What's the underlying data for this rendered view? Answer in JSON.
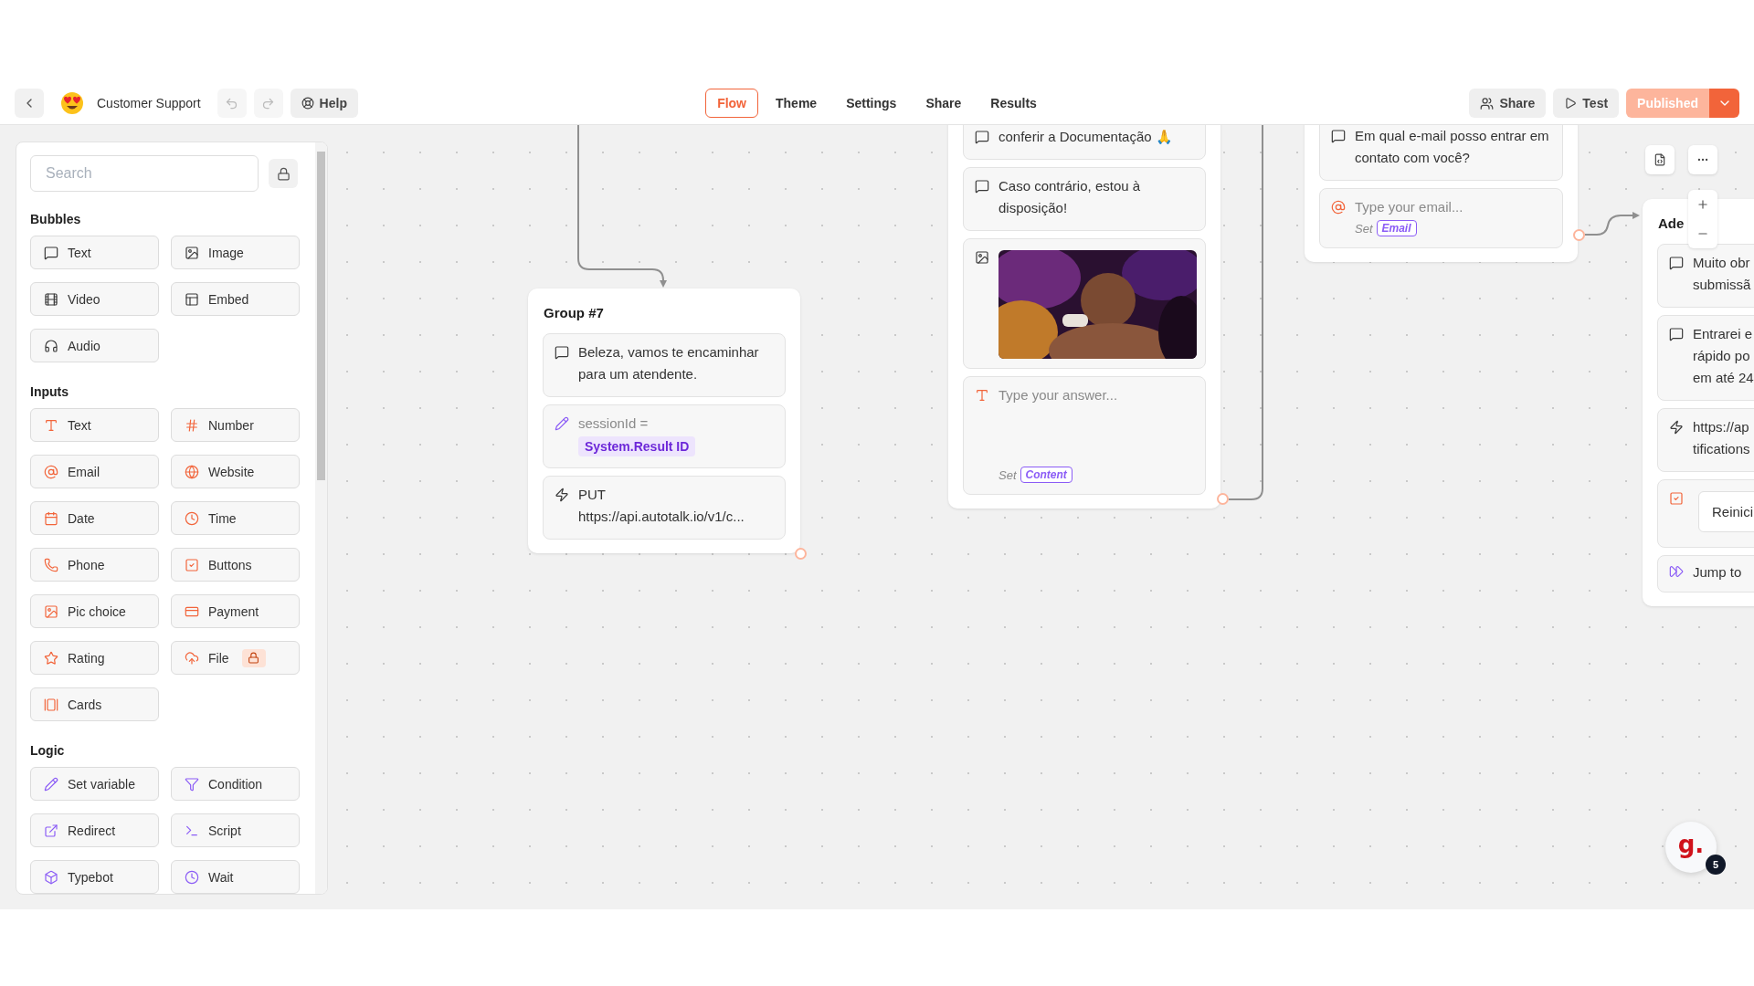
{
  "topbar": {
    "bot_name": "Customer Support",
    "help": "Help",
    "tabs": [
      {
        "label": "Flow",
        "selected": true
      },
      {
        "label": "Theme",
        "selected": false
      },
      {
        "label": "Settings",
        "selected": false
      },
      {
        "label": "Share",
        "selected": false
      },
      {
        "label": "Results",
        "selected": false
      }
    ],
    "share": "Share",
    "test": "Test",
    "publish": "Published"
  },
  "sidebar": {
    "search_placeholder": "Search",
    "sections": [
      {
        "title": "Bubbles",
        "items": [
          {
            "label": "Text",
            "kind": "bubble_text",
            "locked": false
          },
          {
            "label": "Image",
            "kind": "bubble_image",
            "locked": false
          },
          {
            "label": "Video",
            "kind": "bubble_video",
            "locked": false
          },
          {
            "label": "Embed",
            "kind": "bubble_embed",
            "locked": false
          },
          {
            "label": "Audio",
            "kind": "bubble_audio",
            "locked": false
          }
        ]
      },
      {
        "title": "Inputs",
        "items": [
          {
            "label": "Text",
            "kind": "input_text",
            "locked": false
          },
          {
            "label": "Number",
            "kind": "input_number",
            "locked": false
          },
          {
            "label": "Email",
            "kind": "input_email",
            "locked": false
          },
          {
            "label": "Website",
            "kind": "input_website",
            "locked": false
          },
          {
            "label": "Date",
            "kind": "input_date",
            "locked": false
          },
          {
            "label": "Time",
            "kind": "input_time",
            "locked": false
          },
          {
            "label": "Phone",
            "kind": "input_phone",
            "locked": false
          },
          {
            "label": "Buttons",
            "kind": "buttons",
            "locked": false
          },
          {
            "label": "Pic choice",
            "kind": "input_pic",
            "locked": false
          },
          {
            "label": "Payment",
            "kind": "input_payment",
            "locked": false
          },
          {
            "label": "Rating",
            "kind": "input_rating",
            "locked": false
          },
          {
            "label": "File",
            "kind": "input_file",
            "locked": true
          },
          {
            "label": "Cards",
            "kind": "input_cards",
            "locked": false
          }
        ]
      },
      {
        "title": "Logic",
        "items": [
          {
            "label": "Set variable",
            "kind": "set_variable",
            "locked": false
          },
          {
            "label": "Condition",
            "kind": "condition",
            "locked": false
          },
          {
            "label": "Redirect",
            "kind": "redirect",
            "locked": false
          },
          {
            "label": "Script",
            "kind": "script",
            "locked": false
          },
          {
            "label": "Typebot",
            "kind": "typebot",
            "locked": false
          },
          {
            "label": "Wait",
            "kind": "wait",
            "locked": false
          }
        ]
      }
    ]
  },
  "canvas": {
    "groups": [
      {
        "title": "Group #7",
        "blocks": [
          {
            "kind": "bubble_text",
            "text": "Beleza, vamos te encaminhar para um atendente."
          },
          {
            "kind": "set_variable",
            "text": "sessionId =",
            "value": "System.Result ID"
          },
          {
            "kind": "webhook",
            "text": "PUT\nhttps://api.autotalk.io/v1/c..."
          }
        ]
      },
      {
        "blocks": [
          {
            "kind": "bubble_text",
            "text": "conferir a Documentação 🙏"
          },
          {
            "kind": "bubble_text",
            "text": "Caso contrário, estou à disposição!"
          },
          {
            "kind": "bubble_image"
          },
          {
            "kind": "input_text",
            "placeholder": "Type your answer...",
            "set": "Set",
            "variable": "Content"
          }
        ]
      },
      {
        "blocks": [
          {
            "kind": "bubble_text",
            "text": "Em qual e-mail posso entrar em contato com você?"
          },
          {
            "kind": "input_email",
            "placeholder": "Type your email...",
            "set": "Set",
            "variable": "Email"
          }
        ]
      },
      {
        "title": "Ade",
        "blocks": [
          {
            "kind": "bubble_text",
            "text": "Muito obr\nsubmissã"
          },
          {
            "kind": "bubble_text",
            "text": "Entrarei e\nrápido po\nem até 24"
          },
          {
            "kind": "webhook",
            "text": "https://ap\ntifications"
          },
          {
            "kind": "buttons",
            "items": [
              "Reinici"
            ]
          },
          {
            "kind": "jump",
            "text": "Jump to"
          }
        ]
      }
    ]
  },
  "help_widget": {
    "logo": "g.",
    "badge": "5"
  }
}
